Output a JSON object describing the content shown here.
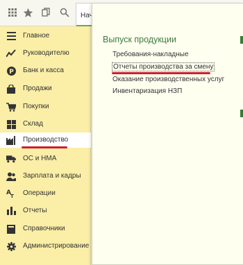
{
  "toolbar": {
    "home_tab_label": "Начальная страница",
    "buttons": [
      "apps-grid-icon",
      "star-icon",
      "history-icon",
      "search-icon"
    ]
  },
  "sidebar": {
    "items": [
      {
        "label": "Главное",
        "icon": "menu-lines-icon"
      },
      {
        "label": "Руководителю",
        "icon": "chart-line-icon"
      },
      {
        "label": "Банк и касса",
        "icon": "ruble-coin-icon"
      },
      {
        "label": "Продажи",
        "icon": "shopping-bag-icon"
      },
      {
        "label": "Покупки",
        "icon": "shopping-cart-icon"
      },
      {
        "label": "Склад",
        "icon": "warehouse-grid-icon"
      },
      {
        "label": "Производство",
        "icon": "factory-icon",
        "active": true
      },
      {
        "label": "ОС и НМА",
        "icon": "truck-icon"
      },
      {
        "label": "Зарплата и кадры",
        "icon": "people-icon"
      },
      {
        "label": "Операции",
        "icon": "operations-icon"
      },
      {
        "label": "Отчеты",
        "icon": "bar-chart-icon"
      },
      {
        "label": "Справочники",
        "icon": "book-icon"
      },
      {
        "label": "Администрирование",
        "icon": "gear-icon"
      }
    ]
  },
  "panel": {
    "section_title": "Выпуск продукции",
    "links": [
      "Требования-накладные",
      "Отчеты производства за смену",
      "Оказание производственных услуг",
      "Инвентаризация НЗП"
    ]
  },
  "colors": {
    "sidebar_bg": "#fbeea7",
    "accent_green": "#3c7a3c",
    "highlight_red": "#cc1f2f",
    "panel_bg": "#fffff0"
  }
}
